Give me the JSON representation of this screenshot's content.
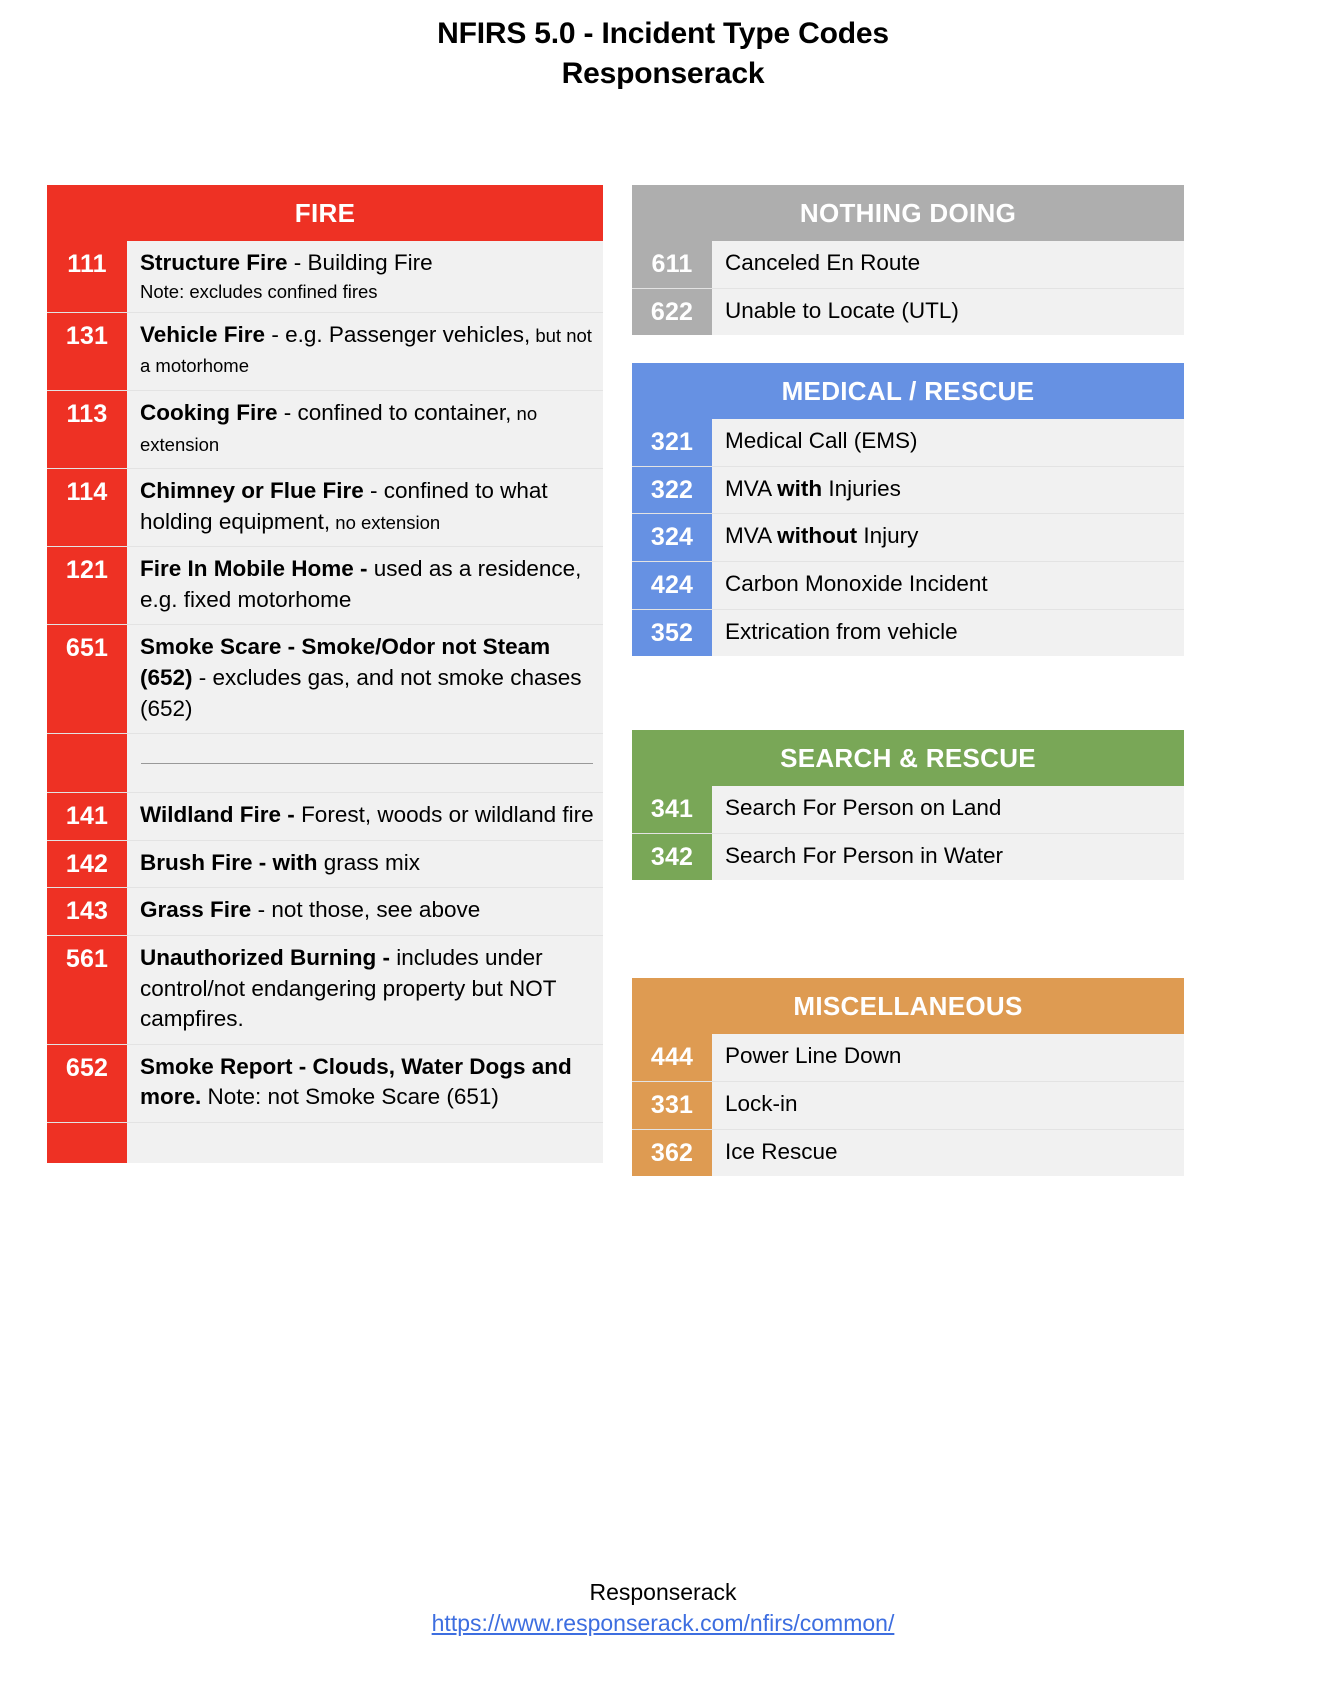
{
  "title": {
    "line1": "NFIRS 5.0 - Incident Type Codes",
    "line2": "Responserack"
  },
  "colors": {
    "fire": "#EE3124",
    "nothing_doing": "#AEAEAE",
    "medical": "#6691E3",
    "search_rescue": "#79A757",
    "miscellaneous": "#DE9B52",
    "row_background": "#F1F1F1",
    "link": "#3D6EE0"
  },
  "sections": {
    "fire": {
      "header": "FIRE",
      "rows": [
        {
          "code": "111",
          "bold": "Structure Fire",
          "rest": " - Building Fire",
          "note": "Note: excludes confined fires"
        },
        {
          "code": "131",
          "bold": "Vehicle Fire",
          "rest": " - e.g. Passenger vehicles,",
          "sub": " but not a motorhome"
        },
        {
          "code": "113",
          "bold": "Cooking Fire",
          "rest": " - confined to container,",
          "sub": " no extension"
        },
        {
          "code": "114",
          "bold": "Chimney or Flue Fire",
          "rest": " - confined to what holding equipment,",
          "sub": " no extension"
        },
        {
          "code": "121",
          "bold": "Fire In Mobile Home -",
          "rest": " used as a residence, e.g. fixed motorhome"
        },
        {
          "code": "651",
          "bold": "Smoke Scare - Smoke/Odor not Steam (652)",
          "rest": " - excludes gas, and not smoke chases (652)"
        },
        {
          "code": "",
          "divider": true
        },
        {
          "code": "141",
          "bold": "Wildland Fire -",
          "rest": " Forest, woods or wildland fire"
        },
        {
          "code": "142",
          "bold": "Brush Fire - with",
          "rest": " grass mix"
        },
        {
          "code": "143",
          "bold": "Grass Fire",
          "rest": " - not those, see above"
        },
        {
          "code": "561",
          "bold": "Unauthorized Burning -",
          "rest": " includes under control/not endangering property but NOT campfires."
        },
        {
          "code": "652",
          "bold": "Smoke Report - Clouds, Water Dogs and more.",
          "rest": " Note: not Smoke Scare (651)"
        },
        {
          "code": "",
          "tail": true
        }
      ]
    },
    "nothing_doing": {
      "header": "NOTHING DOING",
      "rows": [
        {
          "code": "611",
          "rest": "Canceled En Route"
        },
        {
          "code": "622",
          "rest": "Unable to Locate (UTL)"
        }
      ]
    },
    "medical": {
      "header": "MEDICAL / RESCUE",
      "rows": [
        {
          "code": "321",
          "rest": "Medical Call (EMS)"
        },
        {
          "code": "322",
          "pre": "MVA ",
          "bold": "with",
          "rest": " Injuries"
        },
        {
          "code": "324",
          "pre": "MVA ",
          "bold": "without",
          "rest": " Injury"
        },
        {
          "code": "424",
          "rest": "Carbon Monoxide Incident"
        },
        {
          "code": "352",
          "rest": "Extrication from vehicle"
        }
      ]
    },
    "search_rescue": {
      "header": "SEARCH & RESCUE",
      "rows": [
        {
          "code": "341",
          "rest": "Search For Person on Land"
        },
        {
          "code": "342",
          "rest": "Search For Person in Water"
        }
      ]
    },
    "miscellaneous": {
      "header": "MISCELLANEOUS",
      "rows": [
        {
          "code": "444",
          "rest": "Power Line Down"
        },
        {
          "code": "331",
          "rest": "Lock-in"
        },
        {
          "code": "362",
          "rest": "Ice Rescue"
        }
      ]
    }
  },
  "footer": {
    "name": "Responserack",
    "url": "https://www.responserack.com/nfirs/common/"
  }
}
